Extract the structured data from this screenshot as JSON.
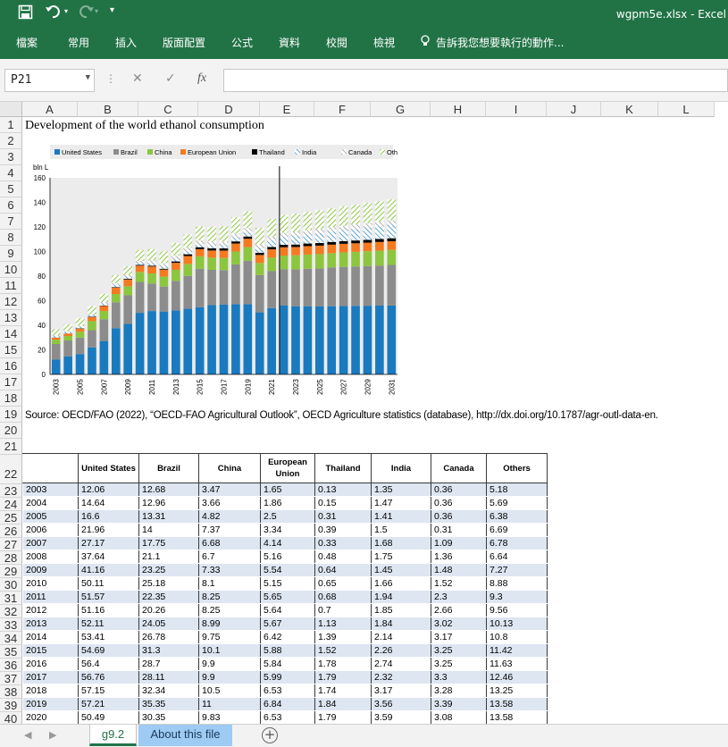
{
  "window": {
    "title": "wgpm5e.xlsx - Excel"
  },
  "quick_access": {
    "save_icon": "save-icon",
    "undo_icon": "undo-icon",
    "redo_icon": "redo-icon",
    "customize_icon": "customize-icon"
  },
  "ribbon": {
    "tabs": [
      "檔案",
      "常用",
      "插入",
      "版面配置",
      "公式",
      "資料",
      "校閱",
      "檢視"
    ],
    "tell_me": "告訴我您想要執行的動作..."
  },
  "formula_bar": {
    "name_box": "P21",
    "cancel_icon": "✕",
    "enter_icon": "✓",
    "fx_label": "fx",
    "value": ""
  },
  "columns": [
    "A",
    "B",
    "C",
    "D",
    "E",
    "F",
    "G",
    "H",
    "I",
    "J",
    "K",
    "L"
  ],
  "rows": [
    "1",
    "2",
    "3",
    "4",
    "5",
    "6",
    "7",
    "8",
    "9",
    "10",
    "11",
    "12",
    "13",
    "14",
    "15",
    "16",
    "17",
    "18",
    "19",
    "20",
    "21",
    "22",
    "23",
    "24",
    "25",
    "26",
    "27",
    "28",
    "29",
    "30",
    "31",
    "32",
    "33",
    "34",
    "35",
    "36",
    "37",
    "38",
    "39",
    "40"
  ],
  "sheet": {
    "title": "Development of the world ethanol consumption",
    "source": "Source: OECD/FAO (2022), “OECD-FAO Agricultural Outlook”, OECD Agriculture statistics (database), http://dx.doi.org/10.1787/agr-outl-data-en."
  },
  "table": {
    "headers": [
      "",
      "United States",
      "Brazil",
      "China",
      "European Union",
      "Thailand",
      "India",
      "Canada",
      "Others"
    ],
    "rows": [
      [
        "2003",
        "12.06",
        "12.68",
        "3.47",
        "1.65",
        "0.13",
        "1.35",
        "0.36",
        "5.18"
      ],
      [
        "2004",
        "14.64",
        "12.96",
        "3.66",
        "1.86",
        "0.15",
        "1.47",
        "0.36",
        "5.69"
      ],
      [
        "2005",
        "16.6",
        "13.31",
        "4.82",
        "2.5",
        "0.31",
        "1.41",
        "0.36",
        "6.38"
      ],
      [
        "2006",
        "21.96",
        "14",
        "7.37",
        "3.34",
        "0.39",
        "1.5",
        "0.31",
        "6.69"
      ],
      [
        "2007",
        "27.17",
        "17.75",
        "6.68",
        "4.14",
        "0.33",
        "1.68",
        "1.09",
        "6.78"
      ],
      [
        "2008",
        "37.64",
        "21.1",
        "6.7",
        "5.16",
        "0.48",
        "1.75",
        "1.36",
        "6.64"
      ],
      [
        "2009",
        "41.16",
        "23.25",
        "7.33",
        "5.54",
        "0.64",
        "1.45",
        "1.48",
        "7.27"
      ],
      [
        "2010",
        "50.11",
        "25.18",
        "8.1",
        "5.15",
        "0.65",
        "1.66",
        "1.52",
        "8.88"
      ],
      [
        "2011",
        "51.57",
        "22.35",
        "8.25",
        "5.65",
        "0.68",
        "1.94",
        "2.3",
        "9.3"
      ],
      [
        "2012",
        "51.16",
        "20.26",
        "8.25",
        "5.64",
        "0.7",
        "1.85",
        "2.66",
        "9.56"
      ],
      [
        "2013",
        "52.11",
        "24.05",
        "8.99",
        "5.67",
        "1.13",
        "1.84",
        "3.02",
        "10.13"
      ],
      [
        "2014",
        "53.41",
        "26.78",
        "9.75",
        "6.42",
        "1.39",
        "2.14",
        "3.17",
        "10.8"
      ],
      [
        "2015",
        "54.69",
        "31.3",
        "10.1",
        "5.88",
        "1.52",
        "2.26",
        "3.25",
        "11.42"
      ],
      [
        "2016",
        "56.4",
        "28.7",
        "9.9",
        "5.84",
        "1.78",
        "2.74",
        "3.25",
        "11.63"
      ],
      [
        "2017",
        "56.76",
        "28.11",
        "9.9",
        "5.99",
        "1.79",
        "2.32",
        "3.3",
        "12.46"
      ],
      [
        "2018",
        "57.15",
        "32.34",
        "10.5",
        "6.53",
        "1.74",
        "3.17",
        "3.28",
        "13.25"
      ],
      [
        "2019",
        "57.21",
        "35.35",
        "11",
        "6.84",
        "1.84",
        "3.56",
        "3.39",
        "13.58"
      ],
      [
        "2020",
        "50.49",
        "30.35",
        "9.83",
        "6.53",
        "1.79",
        "3.59",
        "3.08",
        "13.58"
      ]
    ]
  },
  "chart_data": {
    "type": "bar",
    "stacked": true,
    "ylabel": "bln L",
    "ylim": [
      0,
      160
    ],
    "yticks": [
      0,
      20,
      40,
      60,
      80,
      100,
      120,
      140,
      160
    ],
    "grid": false,
    "legend_position": "top",
    "x_tick_labels": [
      "2003",
      "2005",
      "2007",
      "2009",
      "2011",
      "2013",
      "2015",
      "2017",
      "2019",
      "2021",
      "2023",
      "2025",
      "2027",
      "2029",
      "2031"
    ],
    "categories": [
      "2003",
      "2004",
      "2005",
      "2006",
      "2007",
      "2008",
      "2009",
      "2010",
      "2011",
      "2012",
      "2013",
      "2014",
      "2015",
      "2016",
      "2017",
      "2018",
      "2019",
      "2020",
      "2021",
      "2022",
      "2023",
      "2024",
      "2025",
      "2026",
      "2027",
      "2028",
      "2029",
      "2030",
      "2031"
    ],
    "series": [
      {
        "name": "United States",
        "color": "#1a7abf",
        "pattern": "solid",
        "values": [
          12.06,
          14.64,
          16.6,
          21.96,
          27.17,
          37.64,
          41.16,
          50.11,
          51.57,
          51.16,
          52.11,
          53.41,
          54.69,
          56.4,
          56.76,
          57.15,
          57.21,
          50.49,
          54,
          56,
          55.5,
          55.5,
          55.3,
          55.5,
          55.7,
          55.8,
          55.9,
          56,
          56.1
        ]
      },
      {
        "name": "Brazil",
        "color": "#8c8c8c",
        "pattern": "solid",
        "values": [
          12.68,
          12.96,
          13.31,
          14,
          17.75,
          21.1,
          23.25,
          25.18,
          22.35,
          20.26,
          24.05,
          26.78,
          31.3,
          28.7,
          28.11,
          32.34,
          35.35,
          30.35,
          30,
          29.5,
          30,
          30.5,
          31,
          31.5,
          31.8,
          32,
          32.3,
          32.6,
          33
        ]
      },
      {
        "name": "China",
        "color": "#8cc63f",
        "pattern": "solid",
        "values": [
          3.47,
          3.66,
          4.82,
          7.37,
          6.68,
          6.7,
          7.33,
          8.1,
          8.25,
          8.25,
          8.99,
          9.75,
          10.1,
          9.9,
          9.9,
          10.5,
          11,
          9.83,
          11,
          11.2,
          11.4,
          11.5,
          11.6,
          11.7,
          11.8,
          11.9,
          12,
          12.1,
          12.2
        ]
      },
      {
        "name": "European Union",
        "color": "#f47a20",
        "pattern": "solid",
        "values": [
          1.65,
          1.86,
          2.5,
          3.34,
          4.14,
          5.16,
          5.54,
          5.15,
          5.65,
          5.64,
          5.67,
          6.42,
          5.88,
          5.84,
          5.99,
          6.53,
          6.84,
          6.53,
          6.8,
          6.8,
          6.8,
          6.9,
          6.9,
          6.9,
          7,
          7,
          7,
          7.1,
          7.1
        ]
      },
      {
        "name": "Thailand",
        "color": "#000000",
        "pattern": "solid",
        "values": [
          0.13,
          0.15,
          0.31,
          0.39,
          0.33,
          0.48,
          0.64,
          0.65,
          0.68,
          0.7,
          1.13,
          1.39,
          1.52,
          1.78,
          1.79,
          1.74,
          1.84,
          1.79,
          1.9,
          2,
          2,
          2.1,
          2.1,
          2.2,
          2.2,
          2.3,
          2.3,
          2.4,
          2.4
        ]
      },
      {
        "name": "India",
        "color": "#1a7abf",
        "pattern": "hatch",
        "values": [
          1.35,
          1.47,
          1.41,
          1.5,
          1.68,
          1.75,
          1.45,
          1.66,
          1.94,
          1.85,
          1.84,
          2.14,
          2.26,
          2.74,
          2.32,
          3.17,
          3.56,
          3.59,
          5.5,
          6.5,
          7,
          7.5,
          8,
          8.5,
          9,
          9.5,
          10,
          10.5,
          11
        ]
      },
      {
        "name": "Canada",
        "color": "#8c8c8c",
        "pattern": "hatch",
        "values": [
          0.36,
          0.36,
          0.36,
          0.31,
          1.09,
          1.36,
          1.48,
          1.52,
          2.3,
          2.66,
          3.02,
          3.17,
          3.25,
          3.25,
          3.3,
          3.28,
          3.39,
          3.08,
          3.3,
          3.3,
          3.4,
          3.4,
          3.4,
          3.5,
          3.5,
          3.5,
          3.6,
          3.6,
          3.6
        ]
      },
      {
        "name": "Others",
        "color": "#8cc63f",
        "pattern": "hatch",
        "values": [
          5.18,
          5.69,
          6.38,
          6.69,
          6.78,
          6.64,
          7.27,
          8.88,
          9.3,
          9.56,
          10.13,
          10.8,
          11.42,
          11.63,
          12.46,
          13.25,
          13.58,
          13.58,
          14,
          14.5,
          14.8,
          15,
          15.3,
          15.6,
          15.9,
          16.2,
          16.5,
          16.8,
          17
        ]
      }
    ],
    "vertical_marker_at": "2022"
  },
  "sheet_tabs": [
    "g9.2",
    "About this file"
  ]
}
